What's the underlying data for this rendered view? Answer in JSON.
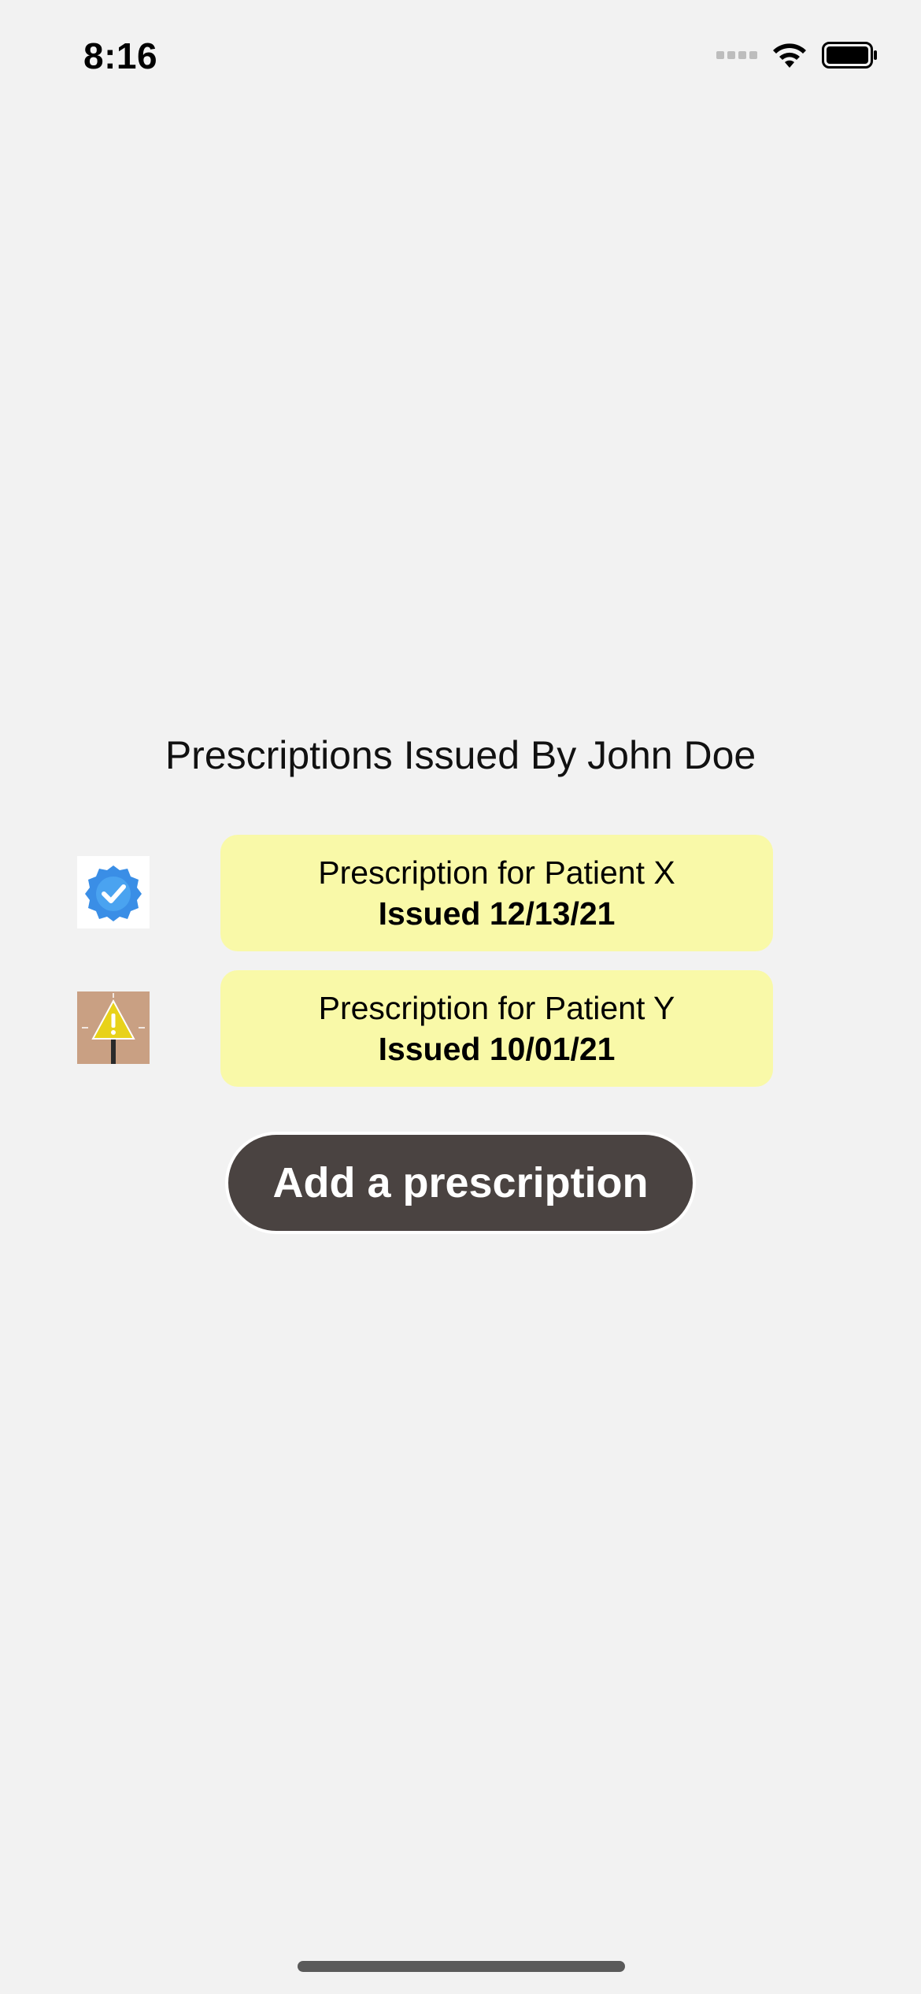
{
  "status_bar": {
    "time": "8:16"
  },
  "page": {
    "title": "Prescriptions Issued By John Doe"
  },
  "prescriptions": [
    {
      "title": "Prescription for Patient X",
      "issued": "Issued 12/13/21",
      "status_icon": "verified-badge-icon",
      "status_color": "#3a8ee6"
    },
    {
      "title": "Prescription for Patient Y",
      "issued": "Issued 10/01/21",
      "status_icon": "warning-sign-icon",
      "status_color": "#e8d21a"
    }
  ],
  "actions": {
    "add_label": "Add a prescription"
  },
  "colors": {
    "background": "#f2f2f2",
    "card": "#f9f9a8",
    "button": "#4a4341",
    "button_text": "#ffffff"
  }
}
